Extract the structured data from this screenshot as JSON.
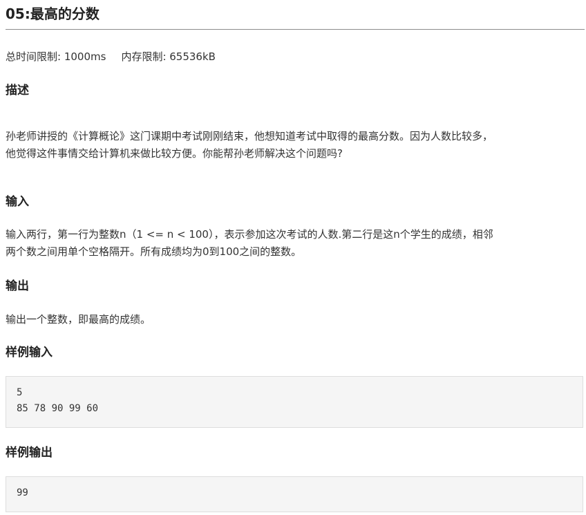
{
  "title": "05:最高的分数",
  "limits": {
    "time": "总时间限制: 1000ms",
    "memory": "内存限制: 65536kB"
  },
  "sections": {
    "description": {
      "heading": "描述",
      "line1": "孙老师讲授的《计算概论》这门课期中考试刚刚结束，他想知道考试中取得的最高分数。因为人数比较多，",
      "line2": "他觉得这件事情交给计算机来做比较方便。你能帮孙老师解决这个问题吗?"
    },
    "input": {
      "heading": "输入",
      "line1": "输入两行，第一行为整数n（1 <= n < 100），表示参加这次考试的人数.第二行是这n个学生的成绩，相邻",
      "line2": "两个数之间用单个空格隔开。所有成绩均为0到100之间的整数。"
    },
    "output": {
      "heading": "输出",
      "line1": "输出一个整数，即最高的成绩。"
    },
    "sample_input": {
      "heading": "样例输入",
      "code": "5\n85 78 90 99 60"
    },
    "sample_output": {
      "heading": "样例输出",
      "code": "99"
    }
  }
}
